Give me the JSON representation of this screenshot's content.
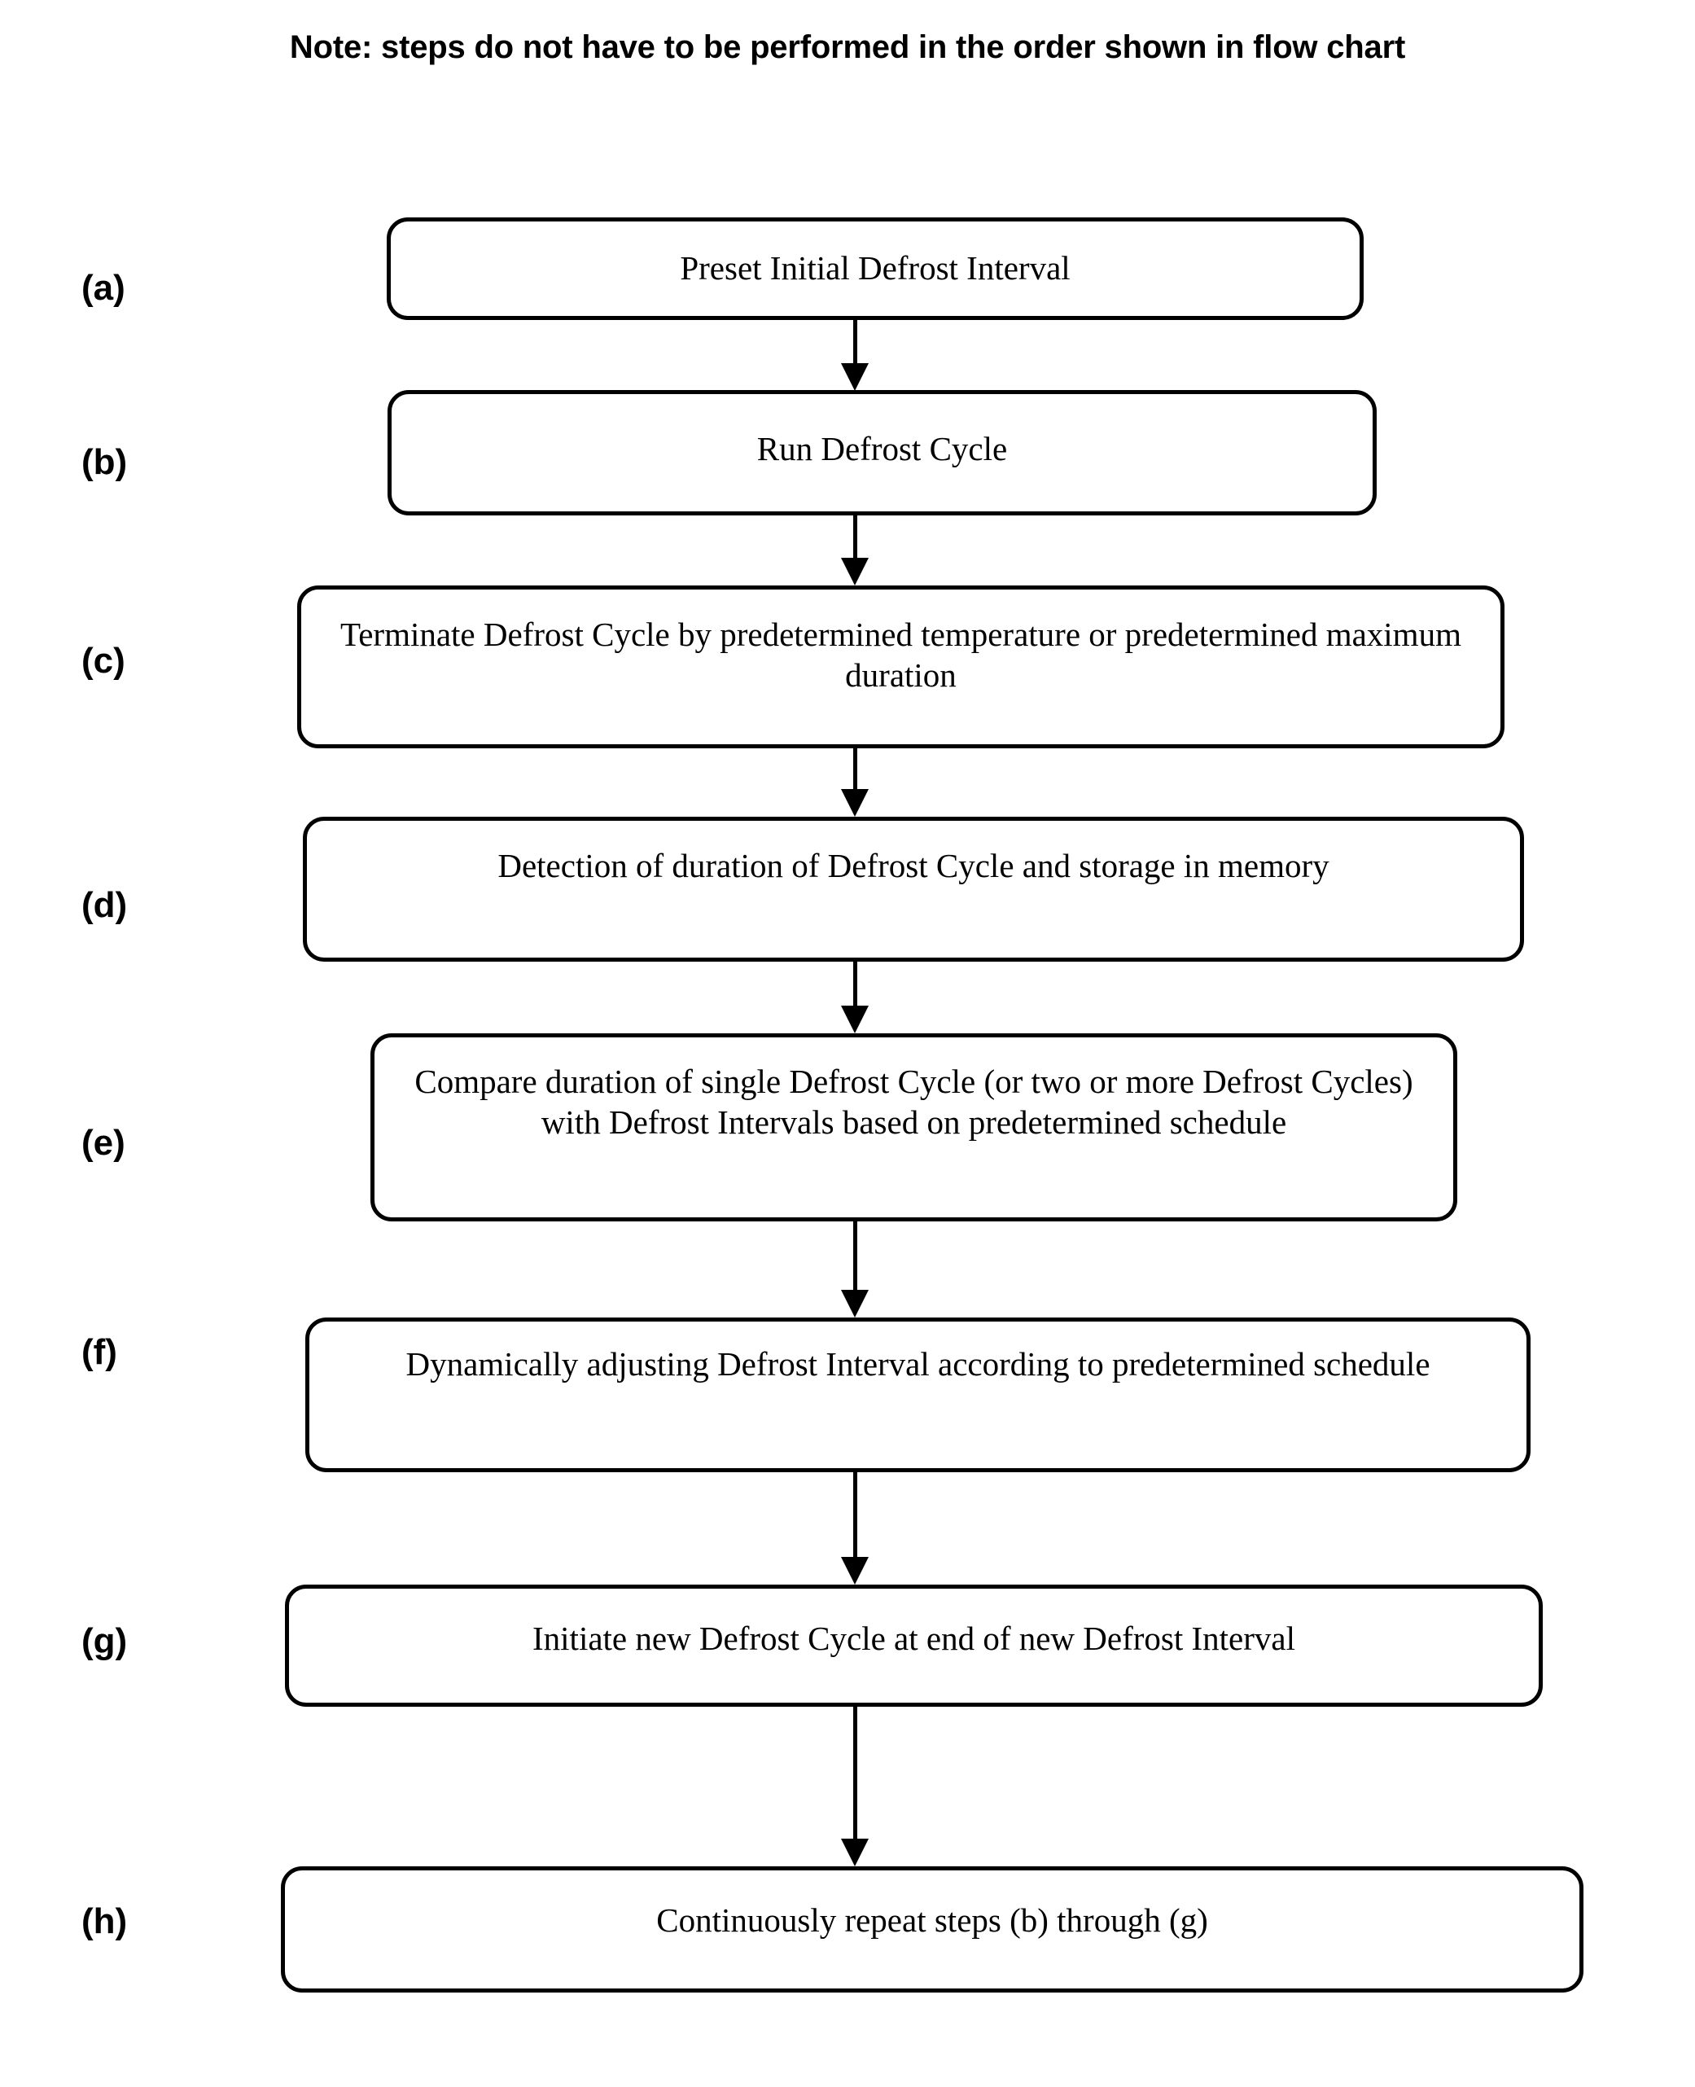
{
  "note": {
    "text": "Note: steps do not have to be performed in the order shown in flow chart"
  },
  "flowchart": {
    "steps": [
      {
        "id": "a",
        "label": "(a)",
        "text": "Preset Initial Defrost Interval"
      },
      {
        "id": "b",
        "label": "(b)",
        "text": "Run Defrost Cycle"
      },
      {
        "id": "c",
        "label": "(c)",
        "text": "Terminate Defrost Cycle by predetermined temperature or predetermined maximum duration"
      },
      {
        "id": "d",
        "label": "(d)",
        "text": "Detection of duration of Defrost Cycle and storage in memory"
      },
      {
        "id": "e",
        "label": "(e)",
        "text": "Compare duration of single Defrost Cycle (or two or more Defrost Cycles) with Defrost Intervals based on predetermined schedule"
      },
      {
        "id": "f",
        "label": "(f)",
        "text": "Dynamically adjusting Defrost Interval according to predetermined schedule"
      },
      {
        "id": "g",
        "label": "(g)",
        "text": "Initiate new Defrost Cycle at end of new Defrost Interval"
      },
      {
        "id": "h",
        "label": "(h)",
        "text": "Continuously repeat steps (b) through (g)"
      }
    ],
    "connectors": [
      {
        "from": "a",
        "to": "b"
      },
      {
        "from": "b",
        "to": "c"
      },
      {
        "from": "c",
        "to": "d"
      },
      {
        "from": "d",
        "to": "e"
      },
      {
        "from": "e",
        "to": "f"
      },
      {
        "from": "f",
        "to": "g"
      },
      {
        "from": "g",
        "to": "h"
      }
    ],
    "colors": {
      "stroke": "#000000",
      "fill": "#ffffff",
      "text": "#000000"
    }
  }
}
